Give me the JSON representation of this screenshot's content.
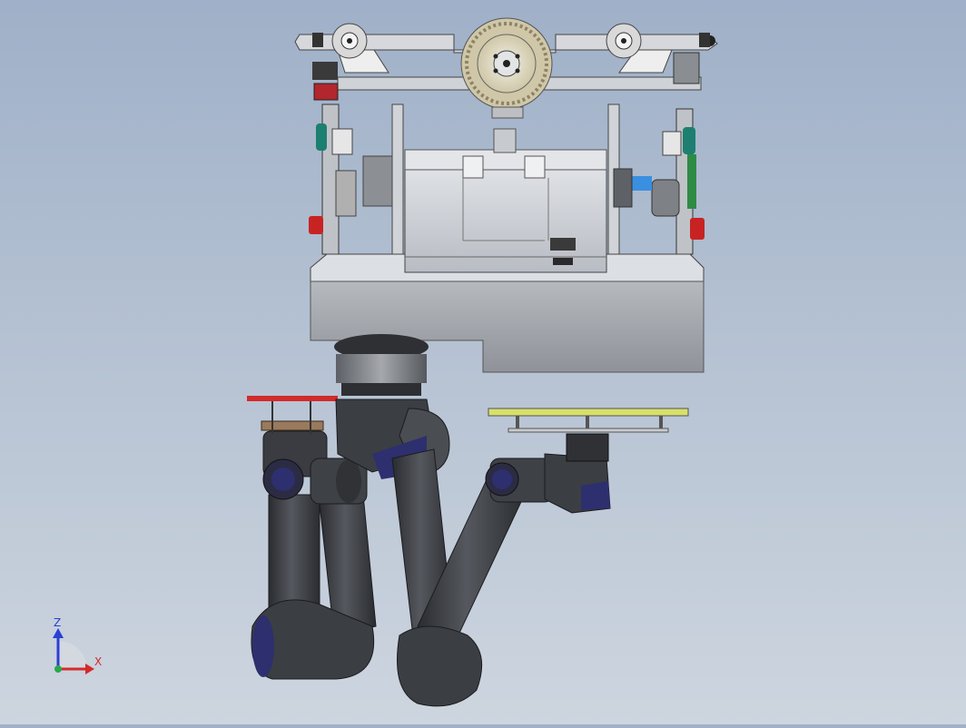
{
  "triad": {
    "z_label": "Z",
    "x_label": "X",
    "z_color": "#2b3fd6",
    "x_color": "#d42a2a",
    "y_color": "#2aa84a"
  },
  "colors": {
    "background_top": "#9fb0c8",
    "background_bottom": "#cdd5df",
    "robot_arm": "#3b3d42",
    "robot_joint_cap": "#2e2f6e",
    "frame_metal": "#c9ccd1",
    "gripper_plate": "#d8e06a",
    "red_clamp": "#d22a2a"
  }
}
